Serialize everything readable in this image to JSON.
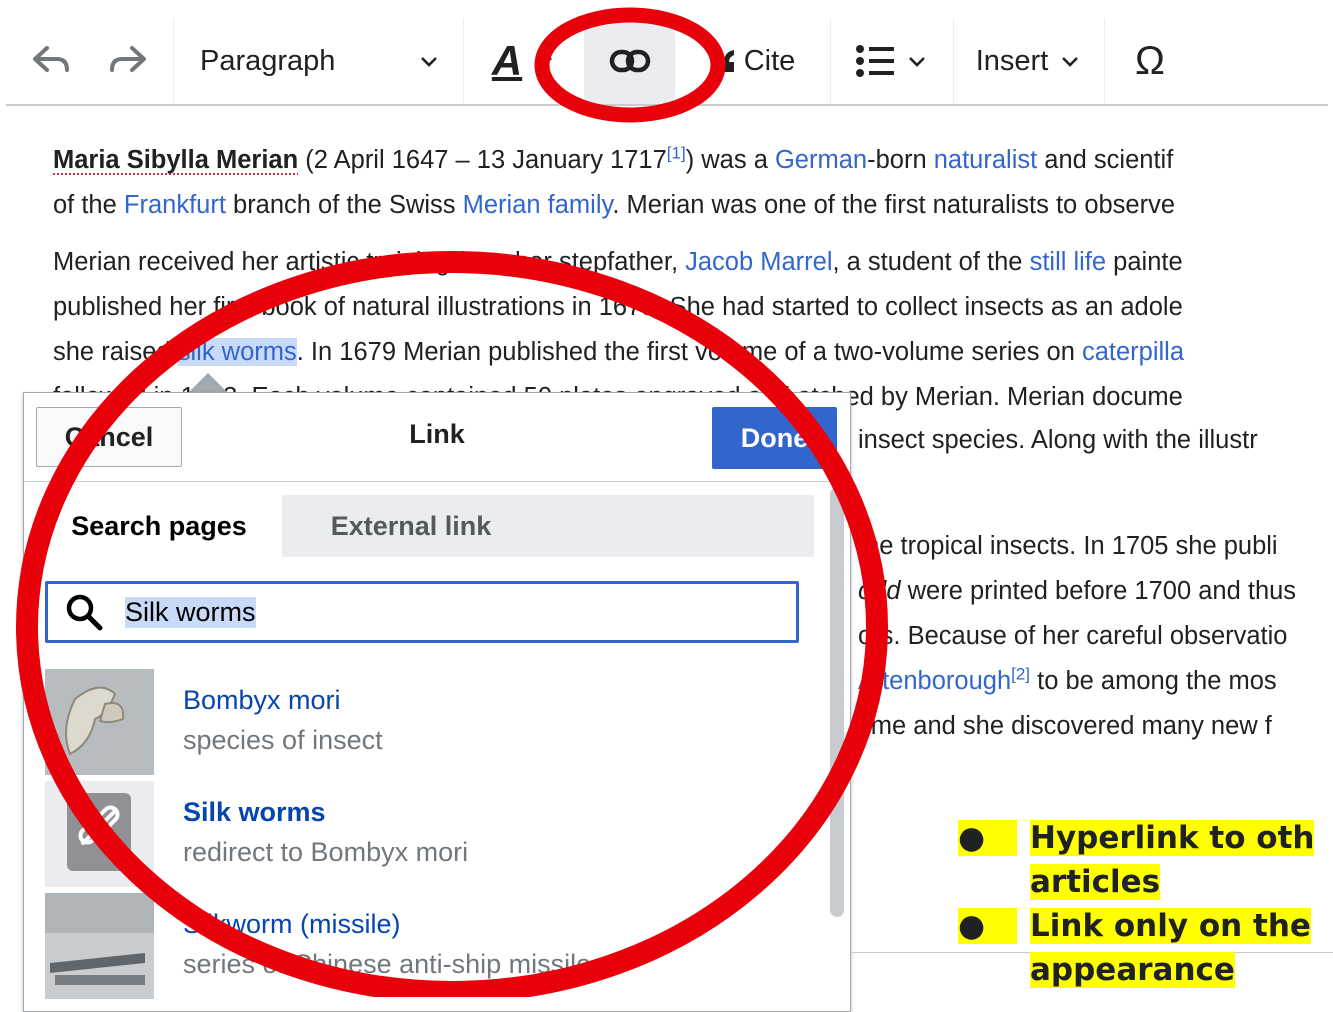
{
  "toolbar": {
    "paragraph_label": "Paragraph",
    "cite_label": "Cite",
    "insert_label": "Insert",
    "style_letter": "A",
    "special_char": "Ω"
  },
  "article": {
    "p1": {
      "name": "Maria Sibylla Merian",
      "t1": " (2 April 1647 – 13 January 1717",
      "ref1": "[1]",
      "t2": ") was a ",
      "link_german": "German",
      "t3": "-born ",
      "link_naturalist": "naturalist",
      "t4": " and scientif",
      "t5": "of the ",
      "link_frankfurt": "Frankfurt",
      "t6": " branch of the Swiss ",
      "link_family": "Merian family",
      "t7": ". Merian was one of the first naturalists to observe"
    },
    "p2": {
      "t1": "Merian received her artistic training from her stepfather, ",
      "link_marrel": "Jacob Marrel",
      "t2": ", a student of the ",
      "link_still_life": "still life",
      "t3": " painte",
      "line2": "published her first book of natural illustrations in 1675. She had started to collect insects as an adole",
      "t4": "she raised ",
      "link_silk": "silk worms",
      "t5": ". In 1679 Merian published the first volume of a two-volume series on ",
      "link_caterpillar": "caterpilla",
      "line4": "followed in 1683. Each volume contained 50 plates engraved and etched by Merian. Merian docume"
    },
    "right_col": {
      "l1": "insect species. Along with the illustr",
      "l2": "the tropical insects. In 1705 she publi",
      "l3_italic": "orld",
      "l3": " were printed before 1700 and thus",
      "l4": "ors. Because of her careful observatio",
      "l5_link": "Attenborough",
      "l5_ref": "[2]",
      "l5": " to be among the mos",
      "l6": "time and she discovered many new f"
    }
  },
  "dialog": {
    "cancel_label": "Cancel",
    "title": "Link",
    "done_label": "Done",
    "tabs": [
      "Search pages",
      "External link"
    ],
    "search_value": "Silk worms",
    "results": [
      {
        "title": "Bombyx mori",
        "desc": "species of insect"
      },
      {
        "title": "Silk worms",
        "desc": "redirect to Bombyx mori"
      },
      {
        "title": "Silkworm (missile)",
        "desc": "series of Chinese anti-ship missiles"
      }
    ]
  },
  "annotations": {
    "bullet1_line1": "Hyperlink to oth",
    "bullet1_line2": "articles",
    "bullet2_line1": "Link only  on the",
    "bullet2_line2": "appearance"
  },
  "colors": {
    "link": "#3366cc",
    "primary_button": "#3366cc",
    "highlight_red": "#e8000b",
    "annotation_highlight": "#ffff00"
  }
}
